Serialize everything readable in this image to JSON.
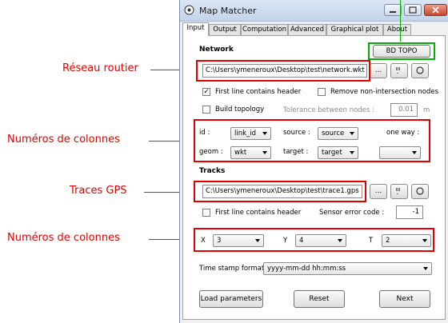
{
  "window": {
    "title": "Map Matcher"
  },
  "tabs": [
    "Input",
    "Output",
    "Computation",
    "Advanced",
    "Graphical plot",
    "About"
  ],
  "annotations": {
    "road_network": "Réseau routier",
    "columns_network": "Numéros de colonnes",
    "gps_traces": "Traces GPS",
    "columns_tracks": "Numéros de colonnes"
  },
  "network": {
    "header": "Network",
    "bd_topo": "BD TOPO",
    "path": "C:\\Users\\ymeneroux\\Desktop\\test\\network.wkt",
    "browse_label": "...",
    "first_line_header": "First line contains header",
    "remove_non_intersection": "Remove non-intersection nodes",
    "build_topology": "Build topology",
    "tolerance_label": "Tolerance between nodes :",
    "tolerance_value": "0.01",
    "tolerance_unit": "m",
    "id_label": "id :",
    "id_value": "link_id",
    "source_label": "source :",
    "source_value": "source",
    "oneway_label": "one way :",
    "geom_label": "geom :",
    "geom_value": "wkt",
    "target_label": "target :",
    "target_value": "target"
  },
  "tracks": {
    "header": "Tracks",
    "path": "C:\\Users\\ymeneroux\\Desktop\\test\\trace1.gps",
    "browse_label": "...",
    "first_line_header": "First line contains header",
    "sensor_error_label": "Sensor error code :",
    "sensor_error_value": "-1",
    "x_label": "X",
    "x_value": "3",
    "y_label": "Y",
    "y_value": "4",
    "t_label": "T",
    "t_value": "2",
    "timestamp_label": "Time stamp format :",
    "timestamp_value": "yyyy-mm-dd hh:mm:ss"
  },
  "buttons": {
    "load": "Load parameters",
    "reset": "Reset",
    "next": "Next"
  }
}
